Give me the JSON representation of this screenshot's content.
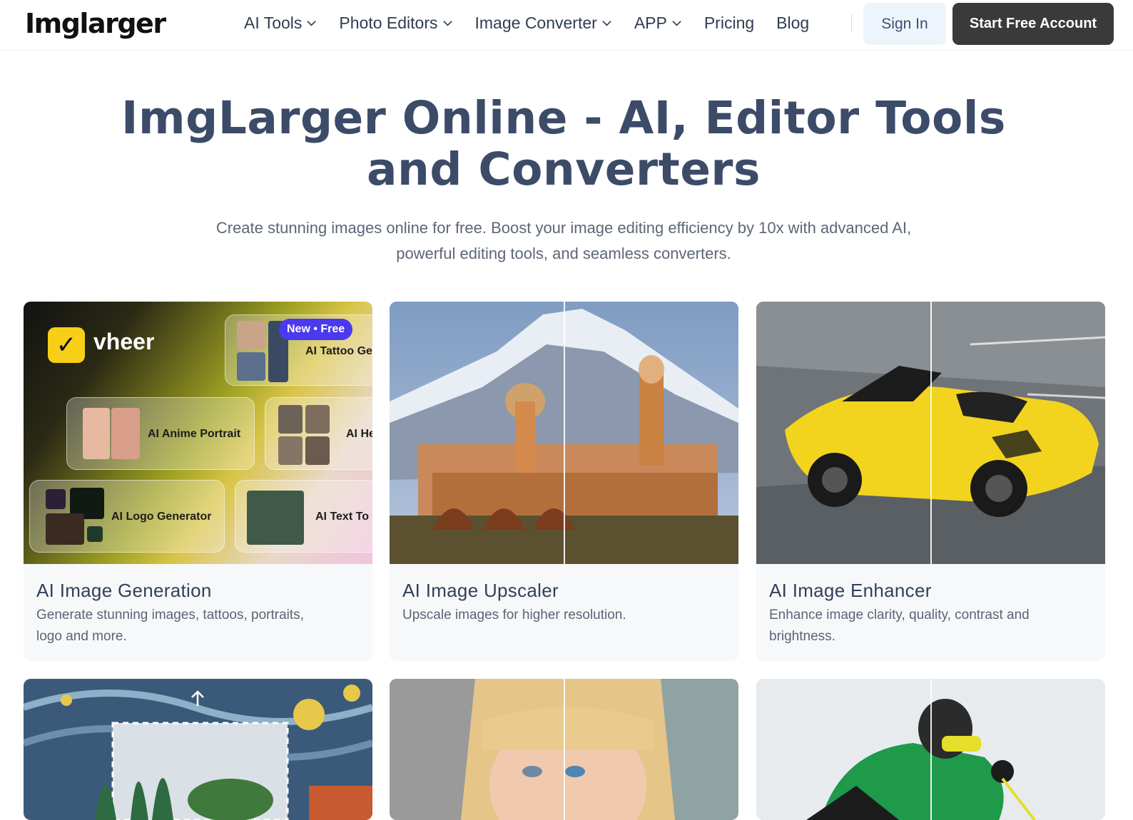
{
  "brand": {
    "logo_text": "Imglarger"
  },
  "nav": {
    "items": [
      {
        "label": "AI Tools",
        "dropdown": true
      },
      {
        "label": "Photo Editors",
        "dropdown": true
      },
      {
        "label": "Image Converter",
        "dropdown": true
      },
      {
        "label": "APP",
        "dropdown": true
      },
      {
        "label": "Pricing",
        "dropdown": false
      },
      {
        "label": "Blog",
        "dropdown": false
      }
    ],
    "sign_in": "Sign In",
    "start_free": "Start Free Account"
  },
  "hero": {
    "title_line1": "ImgLarger Online - AI, Editor Tools",
    "title_line2": "and Converters",
    "subtitle_line1": "Create stunning images online for free. Boost your image editing efficiency by 10x with advanced AI,",
    "subtitle_line2": "powerful editing tools, and seamless converters."
  },
  "cards": [
    {
      "title": "AI Image Generation",
      "desc_line1": "Generate stunning images, tattoos, portraits,",
      "desc_line2": "logo and more.",
      "promo": {
        "brand": "vheer",
        "badge": "New • Free",
        "tiles": [
          "AI Tattoo Ge",
          "AI Anime Portrait",
          "AI He",
          "AI Logo Generator",
          "AI Text To I"
        ]
      }
    },
    {
      "title": "AI Image Upscaler",
      "desc_line1": "Upscale images for higher resolution.",
      "desc_line2": ""
    },
    {
      "title": "AI Image Enhancer",
      "desc_line1": "Enhance image clarity, quality, contrast and",
      "desc_line2": "brightness."
    }
  ],
  "colors": {
    "heading": "#3c4b68",
    "start_button": "#3a3a3a",
    "signin_bg": "#eef4fb",
    "badge": "#4b39ef"
  }
}
